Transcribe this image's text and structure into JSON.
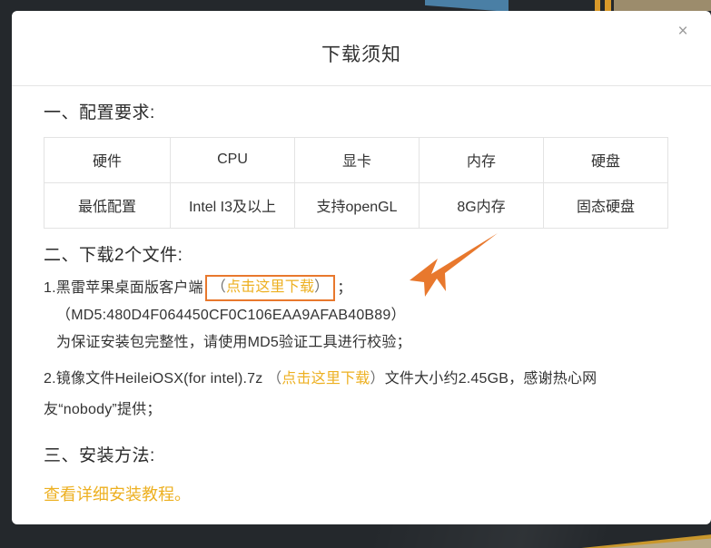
{
  "backdrop": {
    "base_color": "#24282c",
    "accent_blue": "#4a7fa5",
    "accent_orange": "#d9992a",
    "accent_tan": "#9c8c6c",
    "accent_gold": "#c9972c"
  },
  "modal": {
    "title": "下载须知",
    "close_label": "×",
    "sections": {
      "requirements": {
        "heading": "一、配置要求:",
        "table": {
          "headers": [
            "硬件",
            "CPU",
            "显卡",
            "内存",
            "硬盘"
          ],
          "rows": [
            [
              "最低配置",
              "Intel I3及以上",
              "支持openGL",
              "8G内存",
              "固态硬盘"
            ]
          ]
        }
      },
      "downloads": {
        "heading": "二、下载2个文件:",
        "item1": {
          "prefix": "1.黑雷苹果桌面版客户端",
          "paren_open": "（",
          "link_text": "点击这里下载",
          "paren_close": "）",
          "suffix": "；",
          "md5_line": "（MD5:480D4F064450CF0C106EAA9AFAB40B89）",
          "verify_line": "为保证安装包完整性，请使用MD5验证工具进行校验；"
        },
        "item2": {
          "prefix": "2.镜像文件HeileiOSX(for intel).7z",
          "paren_open": "（",
          "link_text": "点击这里下载",
          "paren_close": "）",
          "suffix": "文件大小约2.45GB，感谢热心网友“nobody”提供；"
        }
      },
      "install": {
        "heading": "三、安装方法:",
        "link_text": "查看详细安装教程。"
      }
    }
  },
  "colors": {
    "link_gold": "#edb021",
    "highlight_border": "#e8782d",
    "arrow": "#e8782d",
    "text": "#333333",
    "table_border": "#e3e3e3"
  }
}
